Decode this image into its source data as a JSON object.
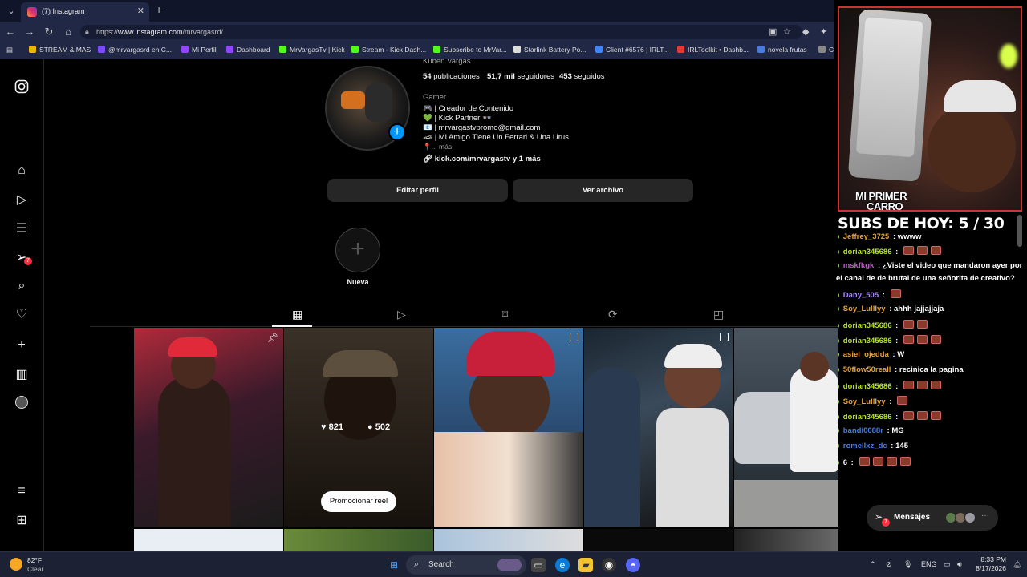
{
  "browser": {
    "tab_title": "(7) Instagram",
    "url_prefix": "https://",
    "url_host": "www.instagram.com",
    "url_path": "/mrvargasrd/",
    "bookmarks": [
      "STREAM & MAS",
      "@mrvargasrd en C...",
      "Mi Perfil",
      "Dashboard",
      "MrVargasTv | Kick",
      "Stream - Kick Dash...",
      "Subscribe to MrVar...",
      "Starlink Battery Po...",
      "Client #6576 | IRLT...",
      "IRLToolkit • Dashb...",
      "novela frutas",
      "Cu"
    ]
  },
  "profile": {
    "name_partial": "Kuben Vargas",
    "posts_count": "54",
    "posts_label": "publicaciones",
    "followers_count": "51,7 mil",
    "followers_label": "seguidores",
    "following_count": "453",
    "following_label": "seguidos",
    "category": "Gamer",
    "bio_lines": [
      "🎮 | Creador de Contenido",
      "💚 | Kick Partner 👓",
      "📧 | mrvargastvpromo@gmail.com",
      "🏎 | Mi Amigo Tiene Un Ferrari & Una Urus",
      "📍... más"
    ],
    "link": "kick.com/mrvargastv y 1 más",
    "edit_button": "Editar perfil",
    "archive_button": "Ver archivo",
    "highlight_new": "Nueva",
    "hover_likes": "821",
    "hover_comments": "502",
    "promote_button": "Promocionar reel"
  },
  "stream": {
    "camera_label_1": "MI PRIMER",
    "camera_label_2": "CARRO",
    "subs_text": "SUBS DE HOY: 5 / 30",
    "chat": [
      {
        "user": "Jeffrey_3725",
        "msg": "wwww",
        "color": "#e5a43a"
      },
      {
        "user": "dorian345686",
        "msg": "",
        "color": "#b5e61d",
        "emotes": 3
      },
      {
        "user": "mskfkgk",
        "msg": "¿Viste el video que mandaron ayer por",
        "color": "#c061cb"
      },
      {
        "user": "",
        "msg": "el canal de de brutal de una señorita de creativo?",
        "color": "#fff"
      },
      {
        "user": "Dany_505",
        "msg": "",
        "color": "#a78bfa",
        "emotes": 1
      },
      {
        "user": "Soy_Lulllyy",
        "msg": "ahhh jajjajjaja",
        "color": "#e5a43a"
      },
      {
        "user": "dorian345686",
        "msg": "",
        "color": "#b5e61d",
        "emotes": 2
      },
      {
        "user": "dorian345686",
        "msg": "",
        "color": "#b5e61d",
        "emotes": 3
      },
      {
        "user": "asiel_ojedda",
        "msg": "W",
        "color": "#e5a43a"
      },
      {
        "user": "50flow50reall",
        "msg": "recinica la pagina",
        "color": "#e5a43a"
      },
      {
        "user": "dorian345686",
        "msg": "",
        "color": "#b5e61d",
        "emotes": 3
      },
      {
        "user": "Soy_Lulllyy",
        "msg": "",
        "color": "#e5a43a",
        "emotes": 1
      },
      {
        "user": "dorian345686",
        "msg": "",
        "color": "#b5e61d",
        "emotes": 3
      },
      {
        "user": "bandi0088r",
        "msg": "MG",
        "color": "#4a7bd6"
      },
      {
        "user": "romellxz_dc",
        "msg": "145",
        "color": "#4a7bd6"
      },
      {
        "user": "6",
        "msg": "",
        "color": "#fff",
        "emotes": 4
      }
    ]
  },
  "messages": {
    "label": "Mensajes",
    "badge": "7"
  },
  "sidebar": {
    "notif_badge": "7"
  },
  "taskbar": {
    "temp": "82°F",
    "condition": "Clear",
    "search": "Search",
    "lang": "ENG",
    "time": "8:33 PM",
    "date": "8/17/2026"
  }
}
